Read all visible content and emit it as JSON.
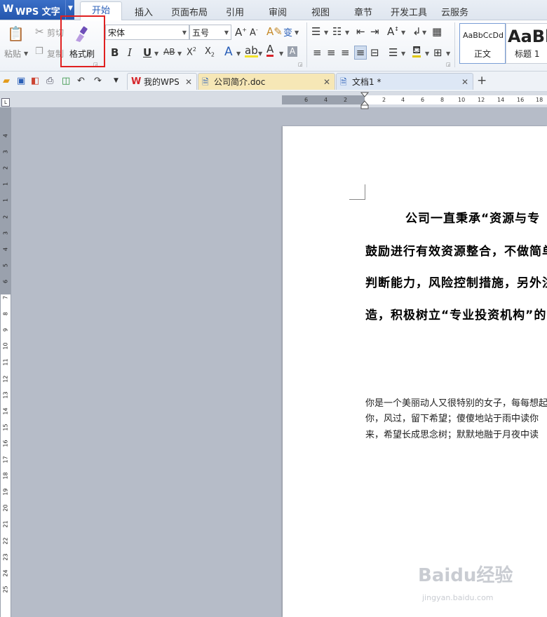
{
  "app": {
    "title": "WPS 文字",
    "logo_glyph": "W"
  },
  "menu": {
    "tabs": [
      "开始",
      "插入",
      "页面布局",
      "引用",
      "审阅",
      "视图",
      "章节",
      "开发工具",
      "云服务"
    ],
    "active": "开始"
  },
  "ribbon": {
    "paste_label": "粘贴",
    "cut_label": "剪切",
    "copy_label": "复制",
    "format_painter_label": "格式刷",
    "font_name": "宋体",
    "font_size": "五号",
    "styles": {
      "normal_preview": "AaBbCcDd",
      "normal_label": "正文",
      "heading_preview": "AaBb",
      "heading_label": "标题 1"
    }
  },
  "highlight_color": "#e02020",
  "doc_tabs": [
    {
      "label": "我的WPS",
      "icon": "wps-logo-icon"
    },
    {
      "label": "公司简介.doc",
      "icon": "doc-icon"
    },
    {
      "label": "文档1 *",
      "icon": "doc-icon"
    }
  ],
  "ruler": {
    "h_numbers": [
      "6",
      "4",
      "2",
      "2",
      "4",
      "6",
      "8",
      "10",
      "12",
      "14",
      "16",
      "18"
    ],
    "v_numbers": [
      "4",
      "3",
      "2",
      "1",
      "1",
      "2",
      "3",
      "4",
      "5",
      "6",
      "7",
      "8",
      "9",
      "10",
      "11",
      "12",
      "13",
      "14",
      "15",
      "16",
      "17",
      "18",
      "19",
      "20",
      "21",
      "22",
      "23",
      "24",
      "25"
    ],
    "corner_label": "L"
  },
  "document": {
    "bold_lines": [
      "公司一直秉承“资源与专",
      "鼓励进行有效资源整合，不做简单",
      "判断能力，风险控制措施，另外注",
      "造，积极树立“专业投资机构”的"
    ],
    "normal_lines": [
      "你是一个美丽动人又很特别的女子，每每想起",
      "你，风过，留下希望；傻傻地站于雨中读你",
      "来，希望长成思念树；默默地融于月夜中读"
    ]
  },
  "watermark": {
    "text": "Baidu经验",
    "sub": "jingyan.baidu.com"
  }
}
